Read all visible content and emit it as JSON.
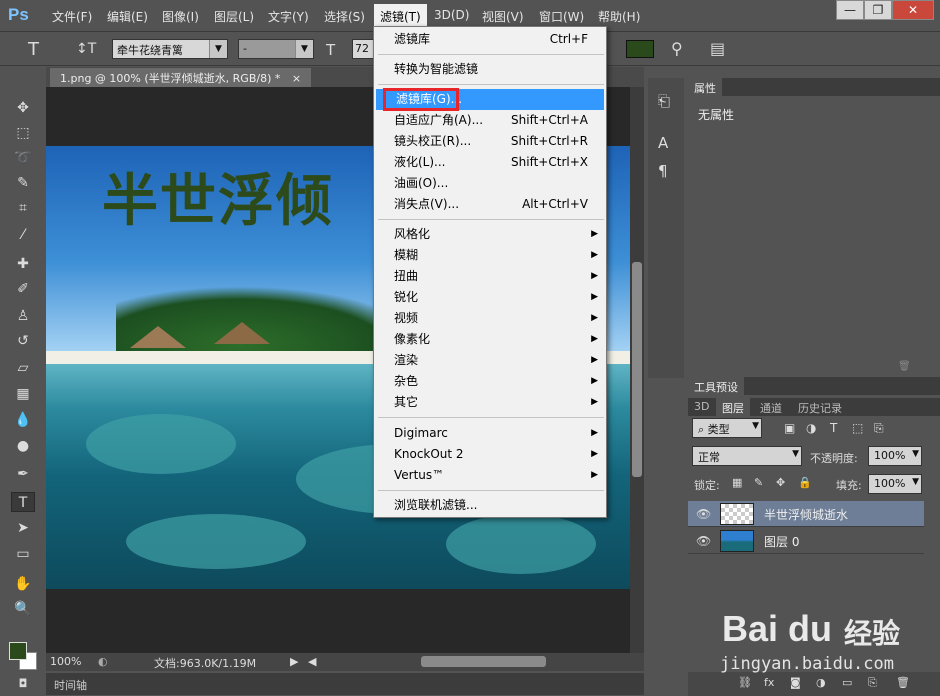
{
  "app": {
    "logo": "Ps"
  },
  "menubar": {
    "items": [
      "文件(F)",
      "编辑(E)",
      "图像(I)",
      "图层(L)",
      "文字(Y)",
      "选择(S)",
      "滤镜(T)",
      "3D(D)",
      "视图(V)",
      "窗口(W)",
      "帮助(H)"
    ],
    "window_buttons": {
      "minimize": "—",
      "restore": "❐",
      "close": "✕"
    }
  },
  "options_bar": {
    "tool_icon": "T",
    "orient_icon": "↕T",
    "font_family": "牵牛花绕青篱",
    "font_style": "-",
    "size_icon": "T",
    "font_size": "72",
    "color": "#2a4a1b"
  },
  "document": {
    "tab_title": "1.png @ 100% (半世浮倾城逝水, RGB/8) *",
    "tab_close": "×",
    "art_text": "半世浮倾"
  },
  "statusbar": {
    "zoom": "100%",
    "doc_info": "文档:963.0K/1.19M",
    "timeline": "时间轴"
  },
  "filter_menu": {
    "items": [
      {
        "label": "滤镜库",
        "shortcut": "Ctrl+F"
      },
      {
        "label": "转换为智能滤镜"
      },
      {
        "label": "滤镜库(G)...",
        "highlighted": true
      },
      {
        "label": "自适应广角(A)...",
        "shortcut": "Shift+Ctrl+A"
      },
      {
        "label": "镜头校正(R)...",
        "shortcut": "Shift+Ctrl+R"
      },
      {
        "label": "液化(L)...",
        "shortcut": "Shift+Ctrl+X"
      },
      {
        "label": "油画(O)..."
      },
      {
        "label": "消失点(V)...",
        "shortcut": "Alt+Ctrl+V"
      },
      {
        "label": "风格化",
        "submenu": true
      },
      {
        "label": "模糊",
        "submenu": true
      },
      {
        "label": "扭曲",
        "submenu": true
      },
      {
        "label": "锐化",
        "submenu": true
      },
      {
        "label": "视频",
        "submenu": true
      },
      {
        "label": "像素化",
        "submenu": true
      },
      {
        "label": "渲染",
        "submenu": true
      },
      {
        "label": "杂色",
        "submenu": true
      },
      {
        "label": "其它",
        "submenu": true
      },
      {
        "label": "Digimarc",
        "submenu": true
      },
      {
        "label": "KnockOut 2",
        "submenu": true
      },
      {
        "label": "Vertus™",
        "submenu": true
      },
      {
        "label": "浏览联机滤镜..."
      }
    ]
  },
  "properties_panel": {
    "tab": "属性",
    "empty_text": "无属性"
  },
  "layers_panel": {
    "tool_presets_tab": "工具预设",
    "tabs": [
      "3D",
      "图层",
      "通道",
      "历史记录"
    ],
    "filter_kind": "类型",
    "blend_mode": "正常",
    "opacity_label": "不透明度:",
    "opacity_value": "100%",
    "lock_label": "锁定:",
    "fill_label": "填充:",
    "fill_value": "100%",
    "layers": [
      {
        "name": "半世浮倾城逝水",
        "selected": true
      },
      {
        "name": "图层 0",
        "selected": false
      }
    ]
  },
  "watermark": {
    "logo": "Bai du",
    "jingyan": "经验",
    "url": "jingyan.baidu.com"
  }
}
